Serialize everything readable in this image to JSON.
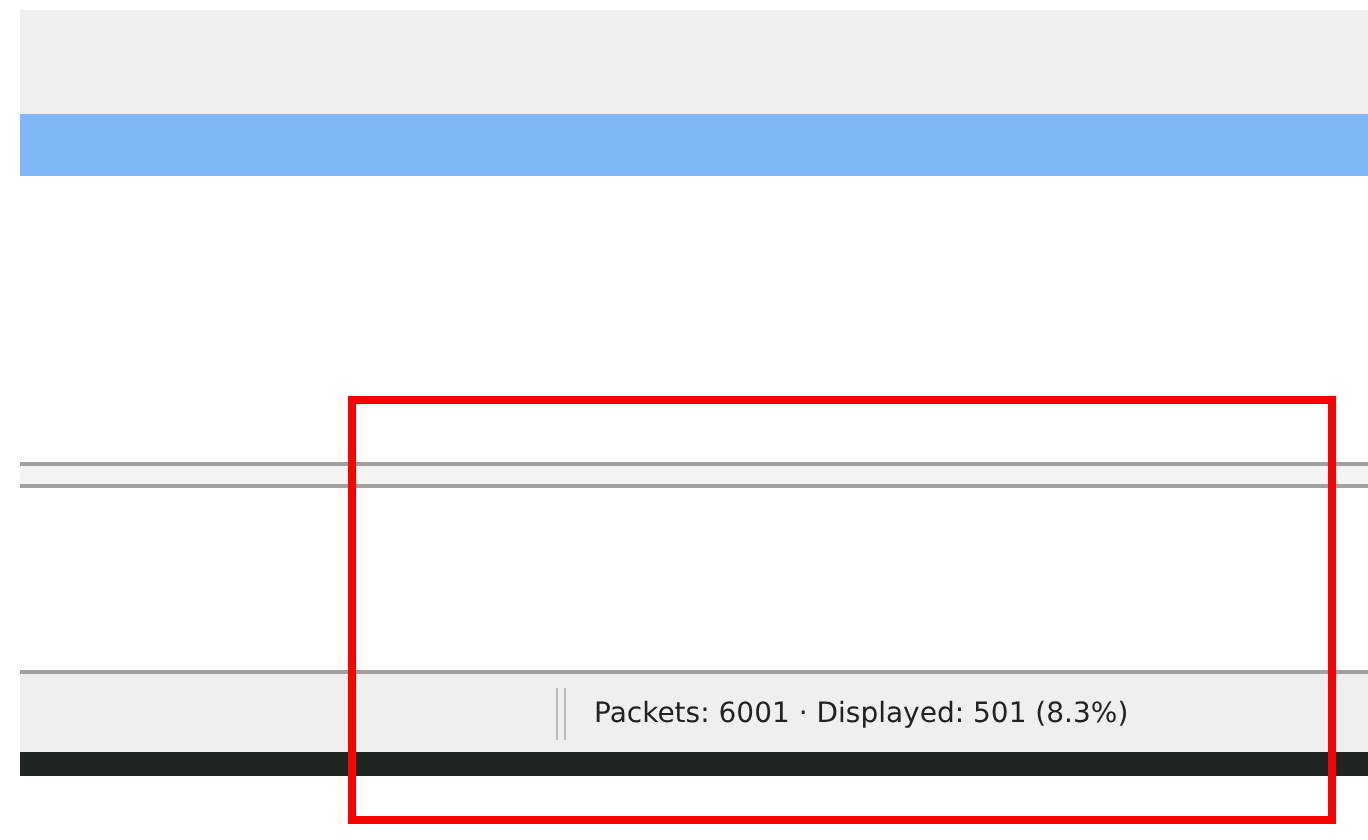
{
  "packet_list": {
    "rows": [
      {
        "selected": true
      }
    ]
  },
  "status_bar": {
    "text": "Packets: 6001 · Displayed: 501 (8.3%)"
  },
  "annotations": [
    {
      "kind": "rectangle"
    }
  ]
}
